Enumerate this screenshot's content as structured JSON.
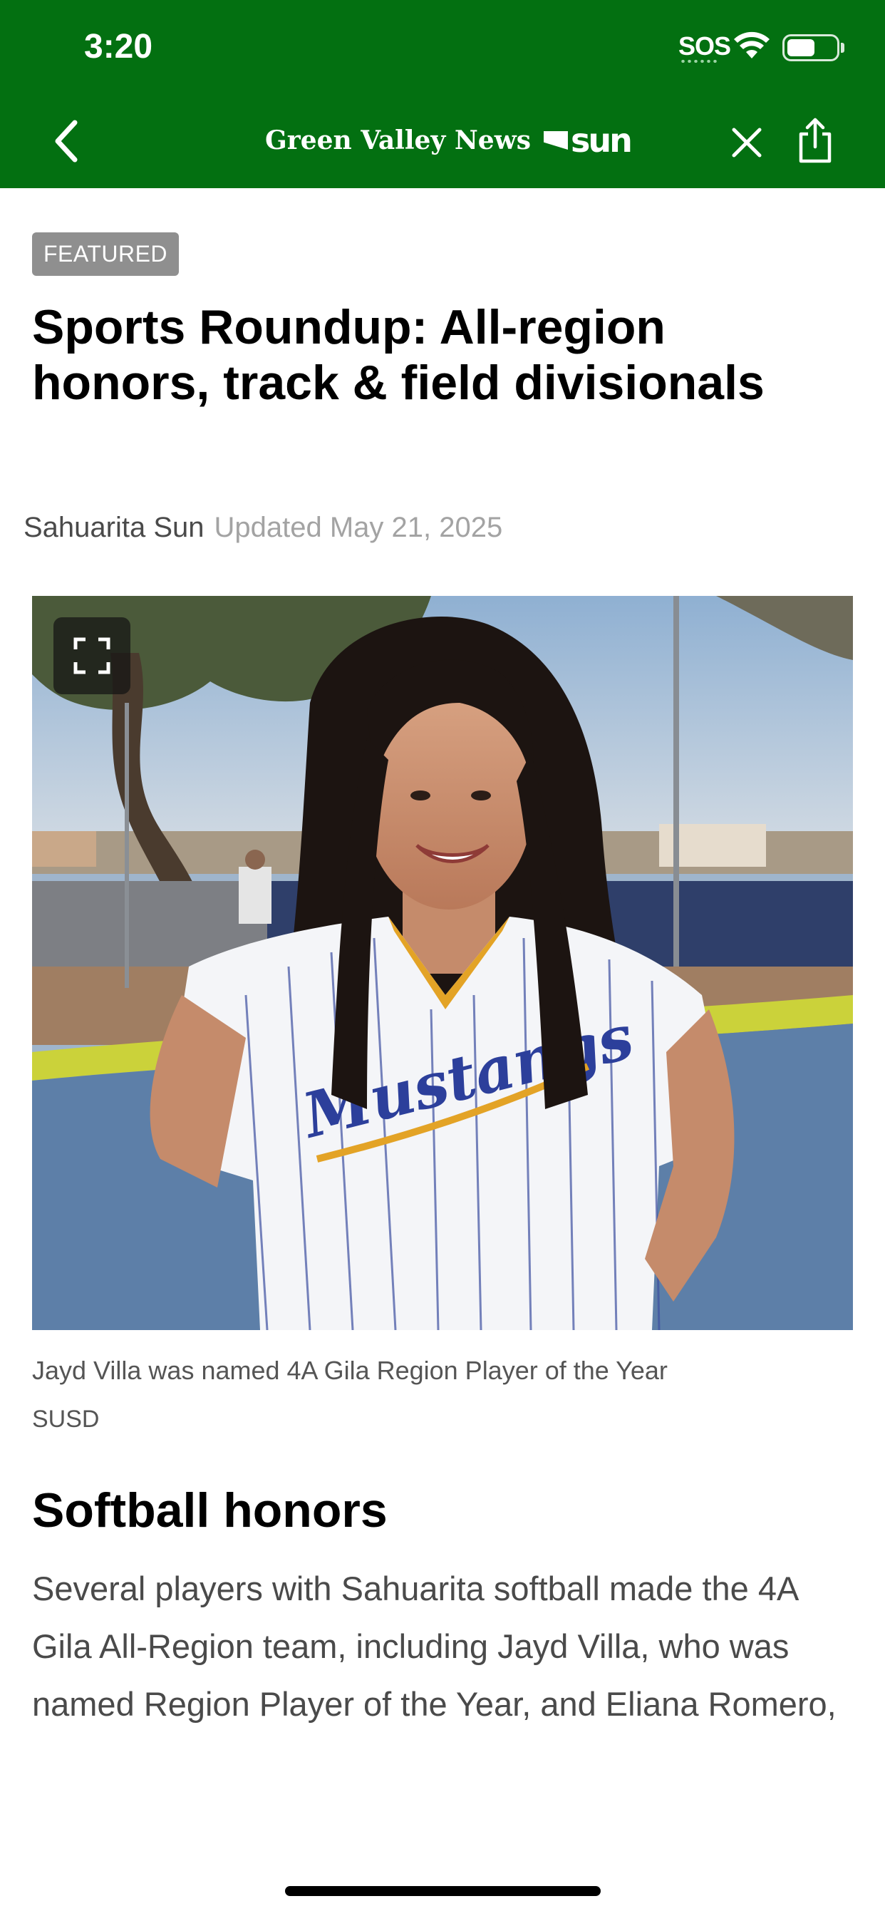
{
  "status_bar": {
    "time": "3:20",
    "carrier": "SOS",
    "icons": [
      "wifi-icon",
      "battery-icon"
    ]
  },
  "nav": {
    "back_icon": "chevron-left-icon",
    "brand_name": "Green Valley News",
    "brand_mark": "sun",
    "close_icon": "close-icon",
    "share_icon": "share-icon"
  },
  "article": {
    "badge": "FEATURED",
    "title": "Sports Roundup: All-region honors, track & field divisionals",
    "source": "Sahuarita Sun",
    "updated": "Updated May 21, 2025",
    "image": {
      "description": "Softball player in white pinstriped Mustangs jersey smiling in front of a ballfield fence",
      "jersey_text": "Mustangs",
      "expand_icon": "expand-icon"
    },
    "caption": "Jayd Villa was named 4A Gila Region Player of the Year",
    "credit": "SUSD",
    "section_heading": "Softball honors",
    "body": "Several players with Sahuarita softball made the 4A Gila All-Region team, including Jayd Villa, who was named Region Player of the Year, and Eliana Romero, who was named Region Offensive Player"
  },
  "colors": {
    "header_green": "#037011",
    "badge_gray": "#8f8f8f",
    "byline_gray": "#a3a3a3"
  }
}
